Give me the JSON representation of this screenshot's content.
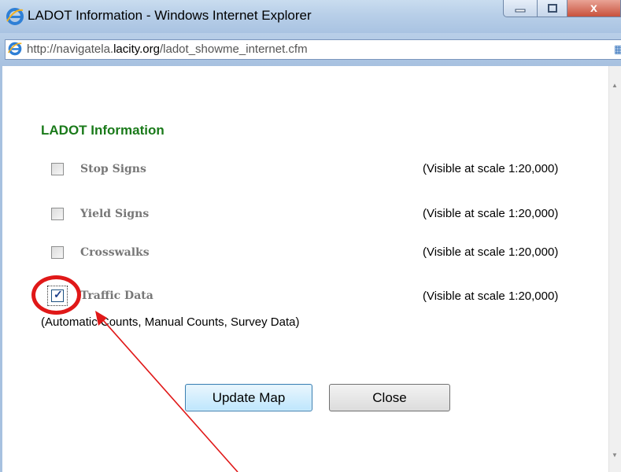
{
  "window": {
    "title": "LADOT Information - Windows Internet Explorer",
    "close_glyph": "x"
  },
  "address": {
    "url_prefix": "http://navigatela.",
    "url_domain": "lacity.org",
    "url_path": "/ladot_showme_internet.cfm"
  },
  "panel": {
    "heading": "LADOT Information",
    "layers": [
      {
        "label": "Stop Signs",
        "scale": "(Visible at scale 1:20,000)",
        "checked": false
      },
      {
        "label": "Yield Signs",
        "scale": "(Visible at scale 1:20,000)",
        "checked": false
      },
      {
        "label": "Crosswalks",
        "scale": "(Visible at scale 1:20,000)",
        "checked": false
      },
      {
        "label": "Traffic Data",
        "scale": "(Visible at scale 1:20,000)",
        "checked": true
      }
    ],
    "traffic_note": "(Automatic Counts, Manual Counts, Survey Data)"
  },
  "buttons": {
    "update": "Update Map",
    "close": "Close"
  },
  "colors": {
    "heading": "#1a7a1a",
    "annotation": "#e01818"
  }
}
